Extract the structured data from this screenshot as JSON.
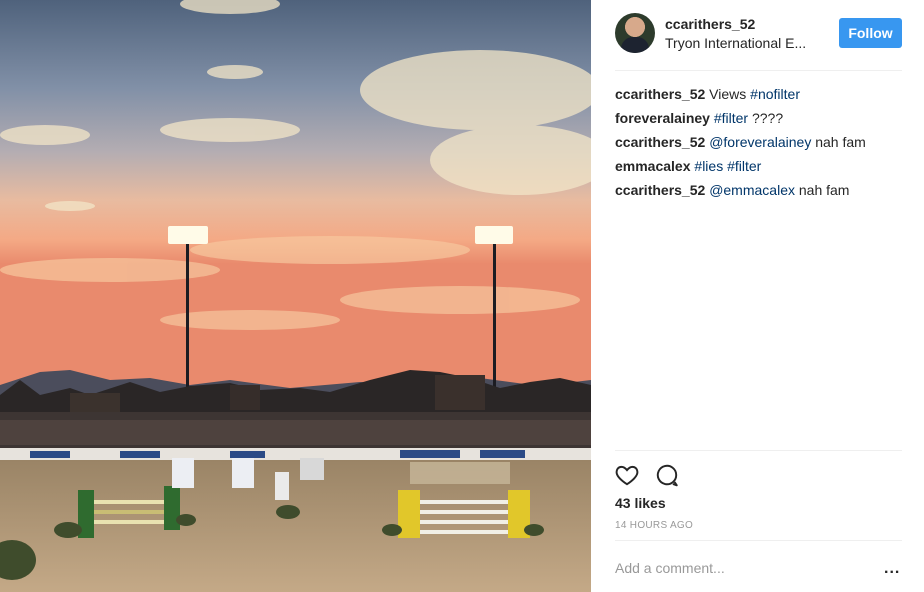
{
  "post": {
    "username": "ccarithers_52",
    "location": "Tryon International E...",
    "follow_label": "Follow"
  },
  "comments": [
    {
      "author": "ccarithers_52",
      "parts": [
        {
          "t": " Views "
        },
        {
          "t": "#nofilter",
          "tag": true
        }
      ]
    },
    {
      "author": "foreveralainey",
      "parts": [
        {
          "t": " "
        },
        {
          "t": "#filter",
          "tag": true
        },
        {
          "t": " ????"
        }
      ]
    },
    {
      "author": "ccarithers_52",
      "parts": [
        {
          "t": " "
        },
        {
          "t": "@foreveralainey",
          "tag": true
        },
        {
          "t": " nah fam"
        }
      ]
    },
    {
      "author": "emmacalex",
      "parts": [
        {
          "t": " "
        },
        {
          "t": "#lies",
          "tag": true
        },
        {
          "t": " "
        },
        {
          "t": "#filter",
          "tag": true
        }
      ]
    },
    {
      "author": "ccarithers_52",
      "parts": [
        {
          "t": " "
        },
        {
          "t": "@emmacalex",
          "tag": true
        },
        {
          "t": " nah fam"
        }
      ]
    }
  ],
  "actions": {
    "like_icon": "heart-icon",
    "comment_icon": "comment-bubble-icon"
  },
  "likes_text": "43 likes",
  "time_text": "14 HOURS AGO",
  "add_comment_placeholder": "Add a comment...",
  "more_label": "...",
  "colors": {
    "accent": "#3897f0",
    "tag": "#003569",
    "muted": "#999999"
  }
}
